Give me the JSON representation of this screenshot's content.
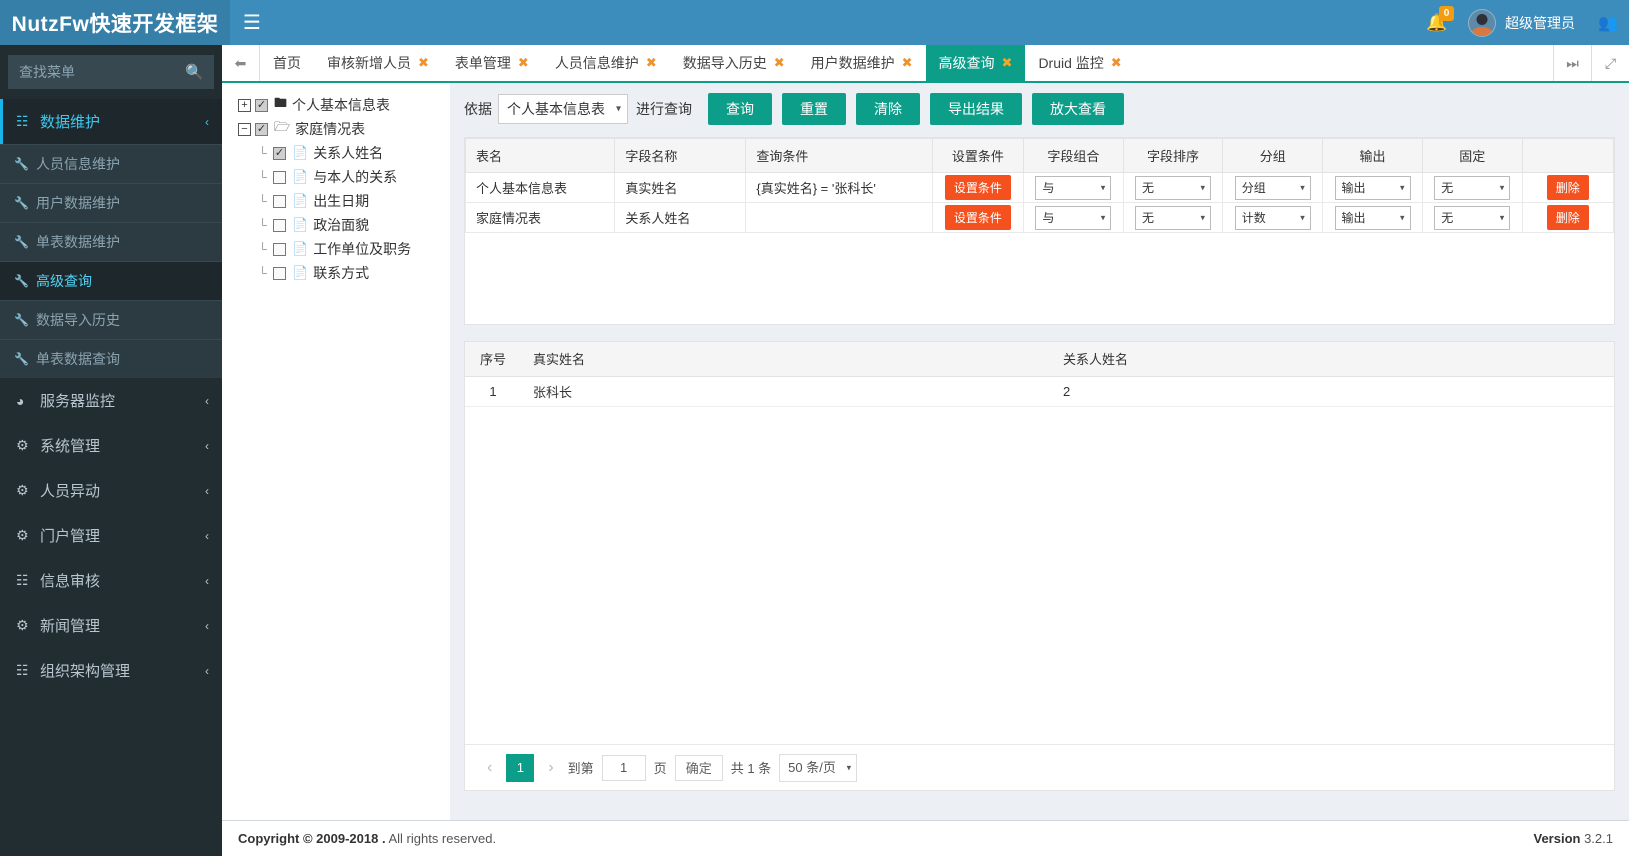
{
  "header": {
    "brand": "NutzFw快速开发框架",
    "menu_icon": "hamburger-icon",
    "notifications_count": "0",
    "username": "超级管理员"
  },
  "sidebar": {
    "search_placeholder": "查找菜单",
    "groups": [
      {
        "label": "数据维护",
        "icon": "sitemap-icon",
        "active": true,
        "children": [
          {
            "label": "人员信息维护",
            "icon": "wrench-icon",
            "active": false
          },
          {
            "label": "用户数据维护",
            "icon": "wrench-icon",
            "active": false
          },
          {
            "label": "单表数据维护",
            "icon": "wrench-icon",
            "active": false
          },
          {
            "label": "高级查询",
            "icon": "wrench-icon",
            "active": true
          },
          {
            "label": "数据导入历史",
            "icon": "wrench-icon",
            "active": false
          },
          {
            "label": "单表数据查询",
            "icon": "wrench-icon",
            "active": false
          }
        ]
      },
      {
        "label": "服务器监控",
        "icon": "dashboard-icon",
        "children": []
      },
      {
        "label": "系统管理",
        "icon": "gears-icon",
        "children": []
      },
      {
        "label": "人员异动",
        "icon": "gears-icon",
        "children": []
      },
      {
        "label": "门户管理",
        "icon": "gears-icon",
        "children": []
      },
      {
        "label": "信息审核",
        "icon": "sitemap-icon",
        "children": []
      },
      {
        "label": "新闻管理",
        "icon": "gears-icon",
        "children": []
      },
      {
        "label": "组织架构管理",
        "icon": "sitemap-icon",
        "children": []
      }
    ]
  },
  "tabs": {
    "prev_icon": "double-chevron-left-icon",
    "next_icon": "double-chevron-right-icon",
    "fullscreen_icon": "expand-icon",
    "items": [
      {
        "label": "首页",
        "closable": false,
        "active": false
      },
      {
        "label": "审核新增人员",
        "closable": true,
        "active": false
      },
      {
        "label": "表单管理",
        "closable": true,
        "active": false
      },
      {
        "label": "人员信息维护",
        "closable": true,
        "active": false
      },
      {
        "label": "数据导入历史",
        "closable": true,
        "active": false
      },
      {
        "label": "用户数据维护",
        "closable": true,
        "active": false
      },
      {
        "label": "高级查询",
        "closable": true,
        "active": true
      },
      {
        "label": "Druid 监控",
        "closable": true,
        "active": false
      }
    ],
    "close_label": "✖"
  },
  "tree": {
    "nodes": [
      {
        "label": "个人基本信息表",
        "toggle": "+",
        "checked": true,
        "icon": "folder-closed-icon",
        "children": []
      },
      {
        "label": "家庭情况表",
        "toggle": "−",
        "checked": true,
        "icon": "folder-open-icon",
        "children": [
          {
            "label": "关系人姓名",
            "checked": true,
            "icon": "file-icon"
          },
          {
            "label": "与本人的关系",
            "checked": false,
            "icon": "file-icon"
          },
          {
            "label": "出生日期",
            "checked": false,
            "icon": "file-icon"
          },
          {
            "label": "政治面貌",
            "checked": false,
            "icon": "file-icon"
          },
          {
            "label": "工作单位及职务",
            "checked": false,
            "icon": "file-icon"
          },
          {
            "label": "联系方式",
            "checked": false,
            "icon": "file-icon"
          }
        ]
      }
    ]
  },
  "toolbar": {
    "prefix_label": "依据",
    "table_select_value": "个人基本信息表",
    "suffix_label": "进行查询",
    "buttons": [
      {
        "label": "查询",
        "name": "query-button"
      },
      {
        "label": "重置",
        "name": "reset-button"
      },
      {
        "label": "清除",
        "name": "clear-button"
      },
      {
        "label": "导出结果",
        "name": "export-button"
      },
      {
        "label": "放大查看",
        "name": "enlarge-button"
      }
    ]
  },
  "condition_table": {
    "headers": [
      "表名",
      "字段名称",
      "查询条件",
      "设置条件",
      "字段组合",
      "字段排序",
      "分组",
      "输出",
      "固定",
      ""
    ],
    "set_button_label": "设置条件",
    "delete_button_label": "删除",
    "rows": [
      {
        "table": "个人基本信息表",
        "field": "真实姓名",
        "condition": "{真实姓名} = '张科长'",
        "combine": "与",
        "sort": "无",
        "group": "分组",
        "output": "输出",
        "fixed": "无"
      },
      {
        "table": "家庭情况表",
        "field": "关系人姓名",
        "condition": "",
        "combine": "与",
        "sort": "无",
        "group": "计数",
        "output": "输出",
        "fixed": "无"
      }
    ]
  },
  "result_table": {
    "headers": [
      "序号",
      "真实姓名",
      "关系人姓名"
    ],
    "rows": [
      {
        "seq": "1",
        "real_name": "张科长",
        "relation_name": "2"
      }
    ]
  },
  "pager": {
    "prev_icon": "chevron-left-icon",
    "next_icon": "chevron-right-icon",
    "current_page": "1",
    "goto_prefix": "到第",
    "goto_value": "1",
    "goto_suffix": "页",
    "confirm_label": "确定",
    "total_label": "共 1 条",
    "page_size": "50 条/页"
  },
  "footer": {
    "copyright_bold": "Copyright © 2009-2018 .",
    "copyright_tail": " All rights reserved.",
    "version_label": "Version",
    "version_value": "3.2.1"
  }
}
